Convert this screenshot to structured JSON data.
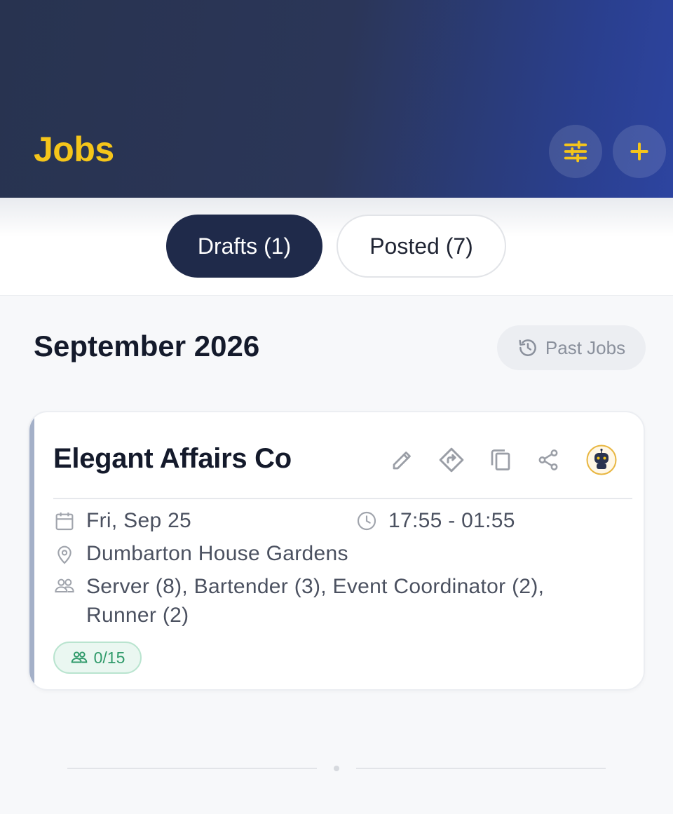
{
  "header": {
    "title": "Jobs",
    "accent_color": "#f5c51a",
    "buttons": [
      {
        "icon": "sliders-icon",
        "label": "filter"
      },
      {
        "icon": "plus-icon",
        "label": "add job"
      }
    ]
  },
  "tabs": [
    {
      "label": "Drafts (1)",
      "active": true
    },
    {
      "label": "Posted (7)",
      "active": false
    }
  ],
  "section": {
    "month": "September 2026",
    "past_jobs_label": "Past Jobs"
  },
  "job": {
    "client": "Elegant Affairs Co",
    "date": "Fri, Sep 25",
    "time": "17:55 - 01:55",
    "location": "Dumbarton House Gardens",
    "roles_line1": "Server (8), Bartender (3), Event Coordinator (2),",
    "roles_line2": "Runner (2)",
    "staffing": "0/15",
    "actions": [
      "edit-icon",
      "directions-icon",
      "copy-icon",
      "share-icon",
      "robot-avatar-icon"
    ]
  },
  "colors": {
    "active_tab": "#1f2a4a",
    "badge_green": "#2f9a6a",
    "card_accent": "#a4b0c8"
  }
}
